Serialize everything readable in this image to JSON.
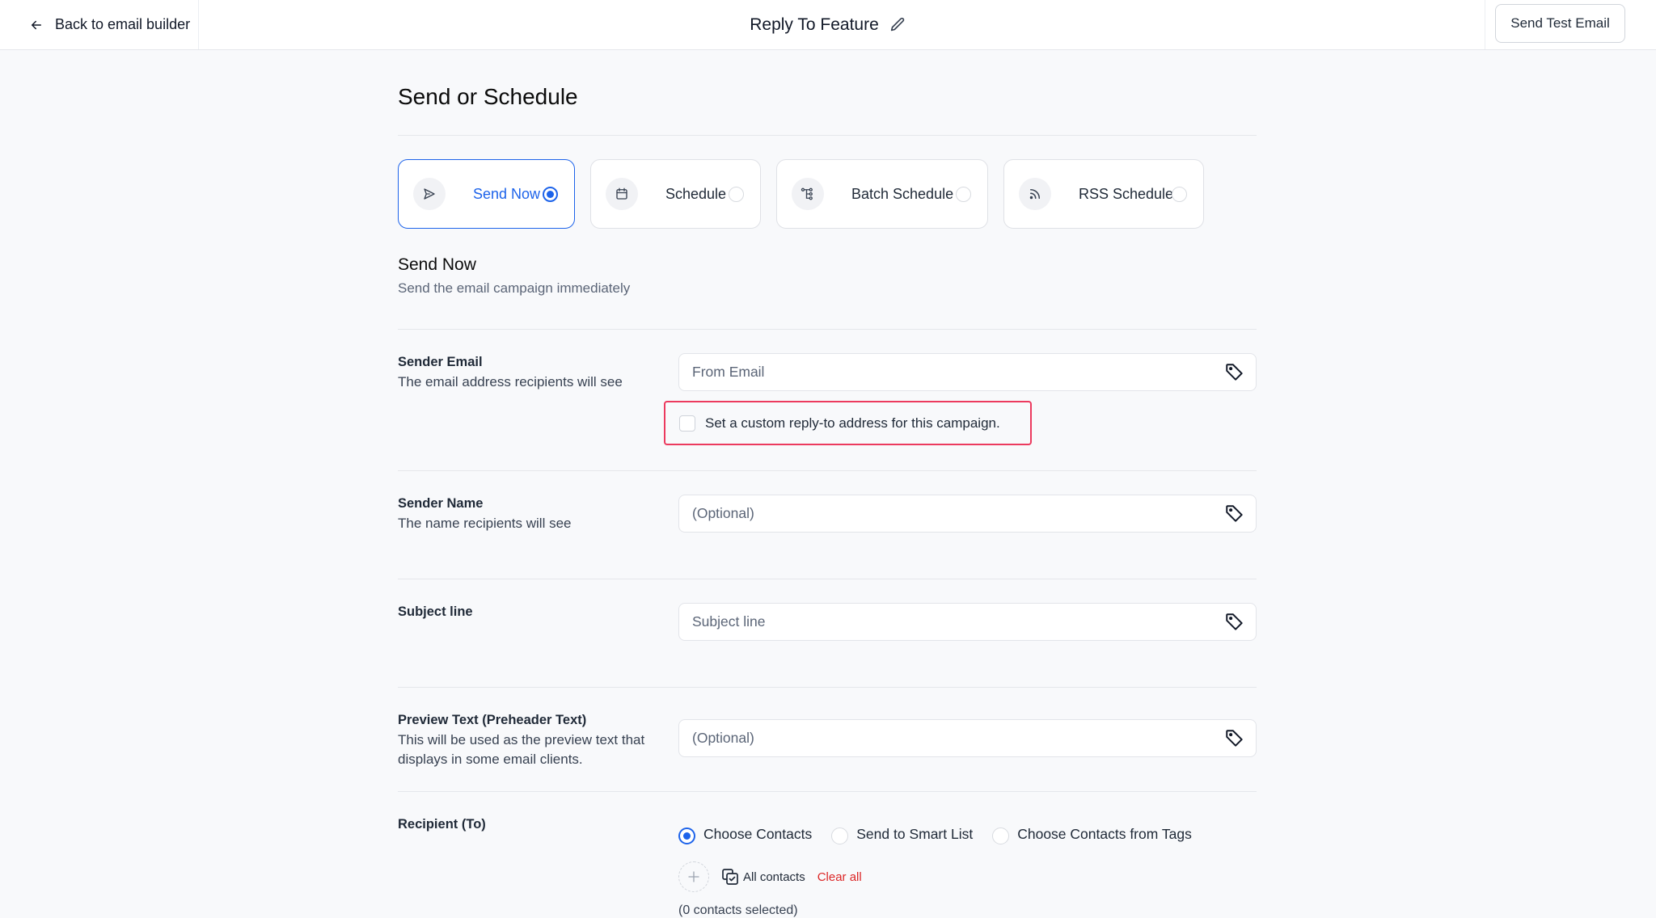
{
  "header": {
    "back_label": "Back to email builder",
    "title": "Reply To Feature",
    "send_test_label": "Send Test Email"
  },
  "page": {
    "title": "Send or Schedule"
  },
  "send_options": [
    {
      "label": "Send Now",
      "icon": "send-icon",
      "selected": true
    },
    {
      "label": "Schedule",
      "icon": "calendar-icon",
      "selected": false
    },
    {
      "label": "Batch Schedule",
      "icon": "batch-tree-icon",
      "selected": false
    },
    {
      "label": "RSS Schedule",
      "icon": "rss-icon",
      "selected": false
    }
  ],
  "section": {
    "title": "Send Now",
    "subtitle": "Send the email campaign immediately"
  },
  "fields": {
    "sender_email": {
      "label": "Sender Email",
      "help": "The email address recipients will see",
      "placeholder": "From Email",
      "value": ""
    },
    "reply_to": {
      "label": "Set a custom reply-to address for this campaign.",
      "checked": false,
      "highlight_color": "#ec3a5e"
    },
    "sender_name": {
      "label": "Sender Name",
      "help": "The name recipients will see",
      "placeholder": "(Optional)",
      "value": ""
    },
    "subject_line": {
      "label": "Subject line",
      "placeholder": "Subject line",
      "value": ""
    },
    "preview_text": {
      "label": "Preview Text (Preheader Text)",
      "help": "This will be used as the preview text that displays in some email clients.",
      "placeholder": "(Optional)",
      "value": ""
    }
  },
  "recipient": {
    "label": "Recipient (To)",
    "options": [
      {
        "label": "Choose Contacts",
        "selected": true
      },
      {
        "label": "Send to Smart List",
        "selected": false
      },
      {
        "label": "Choose Contacts from Tags",
        "selected": false
      }
    ],
    "all_contacts_label": "All contacts",
    "clear_all_label": "Clear all",
    "selected_count_text": "(0 contacts selected)"
  },
  "colors": {
    "accent": "#1d63ea",
    "danger": "#dc2626",
    "background": "#f8f9fb"
  }
}
